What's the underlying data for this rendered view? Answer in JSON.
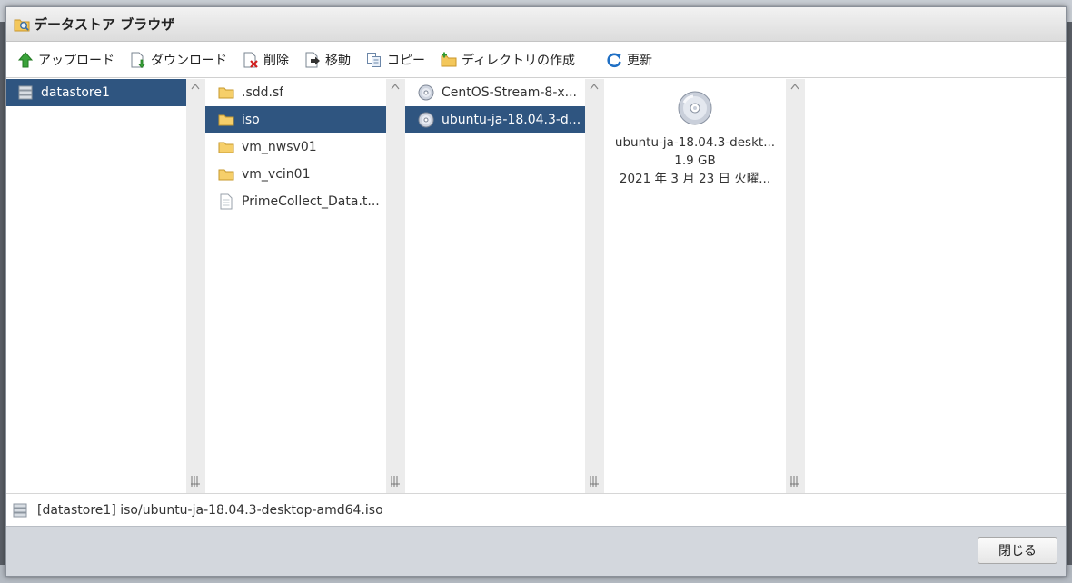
{
  "dialog": {
    "title": "データストア ブラウザ",
    "title_icon": "folder-search-icon"
  },
  "toolbar": {
    "upload": "アップロード",
    "download": "ダウンロード",
    "delete": "削除",
    "move": "移動",
    "copy": "コピー",
    "mkdir": "ディレクトリの作成",
    "refresh": "更新"
  },
  "datastores": [
    {
      "label": "datastore1",
      "icon": "datastore-icon",
      "selected": true
    }
  ],
  "folders": [
    {
      "label": ".sdd.sf",
      "icon": "folder-icon",
      "selected": false
    },
    {
      "label": "iso",
      "icon": "folder-icon",
      "selected": true
    },
    {
      "label": "vm_nwsv01",
      "icon": "folder-icon",
      "selected": false
    },
    {
      "label": "vm_vcin01",
      "icon": "folder-icon",
      "selected": false
    },
    {
      "label": "PrimeCollect_Data.t...",
      "icon": "file-icon",
      "selected": false
    }
  ],
  "files": [
    {
      "label": "CentOS-Stream-8-x...",
      "icon": "disc-icon",
      "selected": false
    },
    {
      "label": "ubuntu-ja-18.04.3-d...",
      "icon": "disc-icon",
      "selected": true
    }
  ],
  "preview": {
    "icon": "disc-icon",
    "name": "ubuntu-ja-18.04.3-deskt...",
    "size": "1.9 GB",
    "date": "2021 年 3 月 23 日 火曜..."
  },
  "status": {
    "path": "[datastore1] iso/ubuntu-ja-18.04.3-desktop-amd64.iso"
  },
  "footer": {
    "close": "閉じる"
  },
  "colors": {
    "selection": "#2f5580",
    "footer_bg": "#d3d7dd"
  }
}
